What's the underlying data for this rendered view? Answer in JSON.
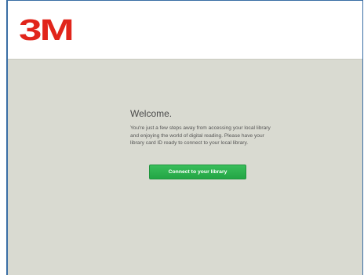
{
  "header": {
    "logo_text": "3M"
  },
  "welcome": {
    "title": "Welcome.",
    "message": "You're just a few steps away from accessing your local library and enjoying the world of digital reading. Please have your library card ID ready to connect to your local library.",
    "button_label": "Connect to your library"
  },
  "colors": {
    "brand_red": "#e1251b",
    "background": "#d9dad1",
    "button_green": "#2db04f",
    "frame_border": "#3a6ea5"
  }
}
